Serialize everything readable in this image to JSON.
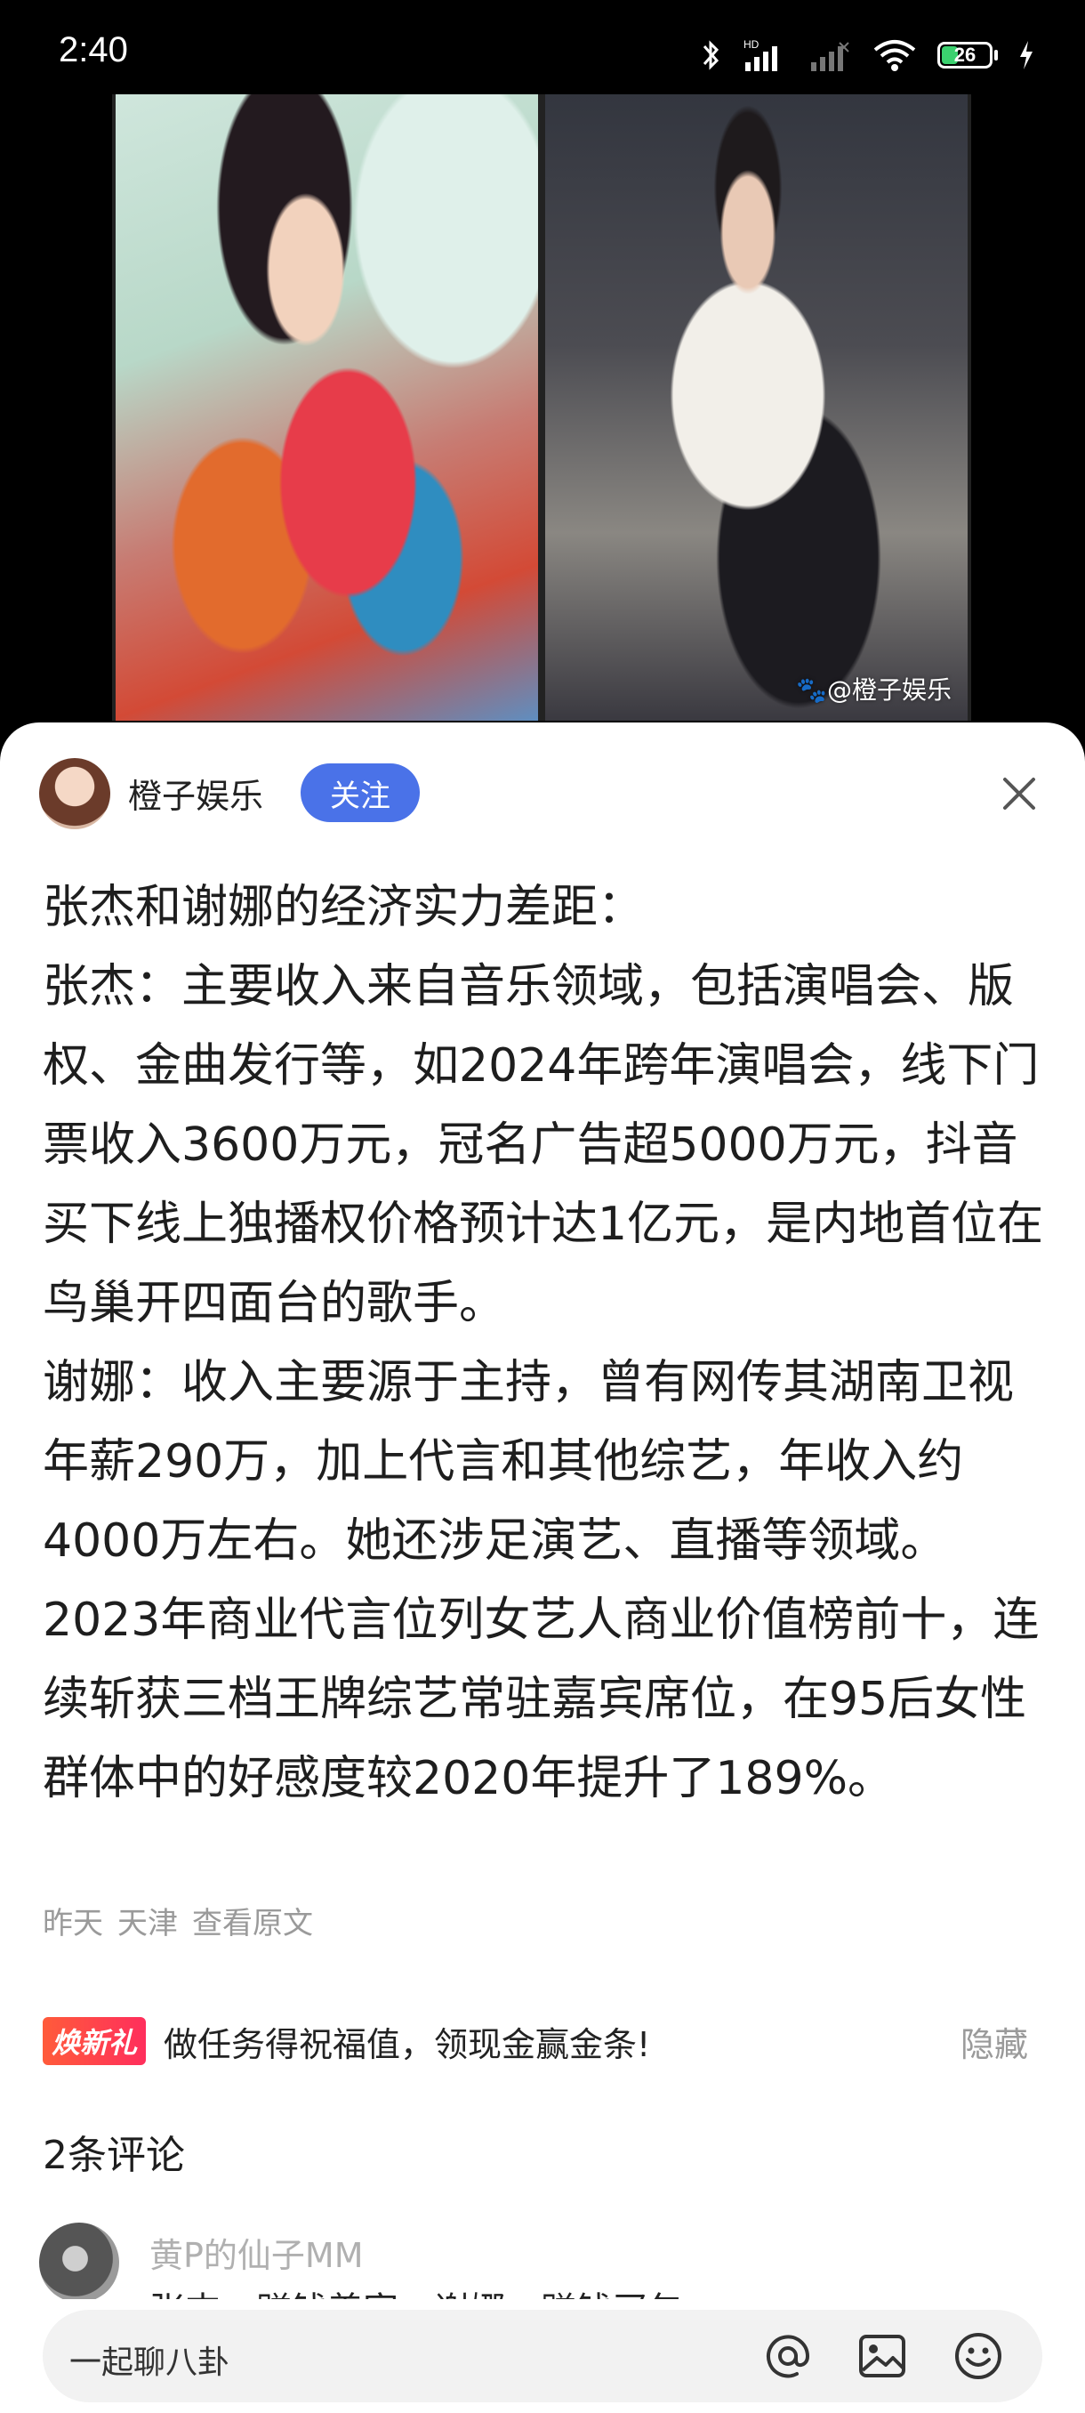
{
  "status_bar": {
    "time": "2:40",
    "battery": "26"
  },
  "photo": {
    "watermark": "🐾@橙子娱乐"
  },
  "author": {
    "name": "橙子娱乐",
    "follow_label": "关注"
  },
  "article": {
    "paragraphs": [
      "张杰和谢娜的经济实力差距：",
      "张杰：主要收入来自音乐领域，包括演唱会、版权、金曲发行等，如2024年跨年演唱会，线下门票收入3600万元，冠名广告超5000万元，抖音买下线上独播权价格预计达1亿元，是内地首位在鸟巢开四面台的歌手。",
      "谢娜：收入主要源于主持，曾有网传其湖南卫视年薪290万，加上代言和其他综艺，年收入约4000万左右。她还涉足演艺、直播等领域。2023年商业代言位列女艺人商业价值榜前十，连续斩获三档王牌综艺常驻嘉宾席位，在95后女性群体中的好感度较2020年提升了189%。"
    ]
  },
  "meta": {
    "date": "昨天",
    "location": "天津",
    "view_original": "查看原文"
  },
  "promo": {
    "badge": "焕新礼",
    "text": "做任务得祝福值，领现金赢金条!",
    "hide_label": "隐藏"
  },
  "comments": {
    "title": "2条评论",
    "items": [
      {
        "user": "黄P的仙子MM",
        "text": "张杰：赚钱养家，谢娜：赚钱买包"
      }
    ]
  },
  "input_bar": {
    "placeholder": "一起聊八卦"
  }
}
